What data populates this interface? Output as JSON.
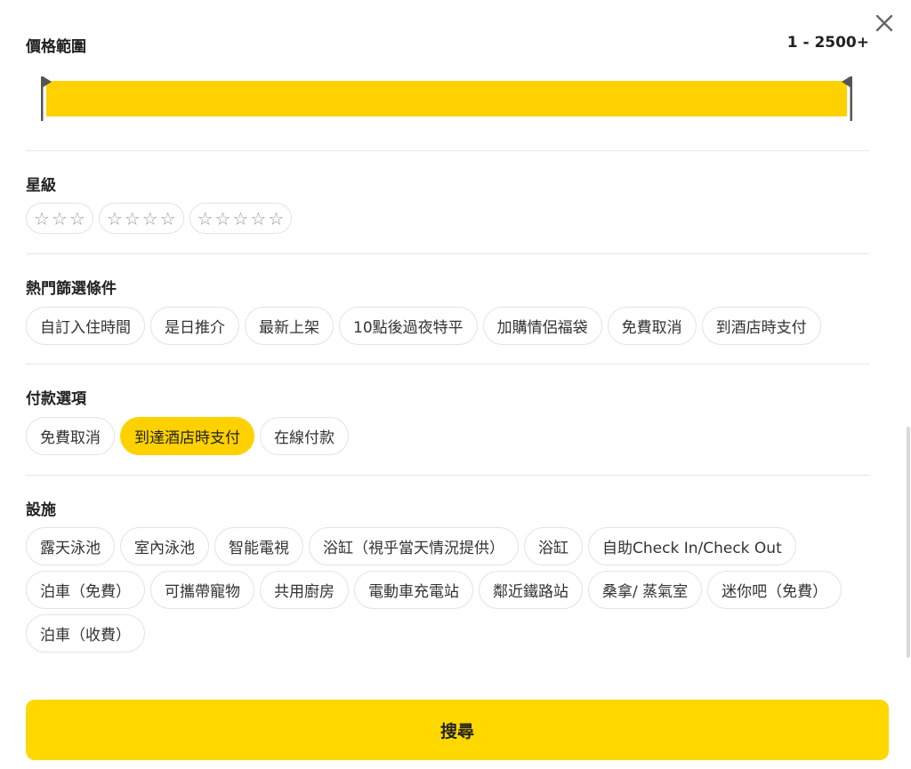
{
  "price": {
    "title": "價格範圍",
    "value": "1 - 2500+",
    "min_fraction": 0,
    "max_fraction": 1,
    "fill_color": "#ffd100"
  },
  "star_rating": {
    "title": "星級",
    "options": [
      {
        "stars": 3
      },
      {
        "stars": 4
      },
      {
        "stars": 5
      }
    ]
  },
  "popular_filters": {
    "title": "熱門篩選條件",
    "chips": [
      "自訂入住時間",
      "是日推介",
      "最新上架",
      "10點後過夜特平",
      "加購情侶福袋",
      "免費取消",
      "到酒店時支付"
    ]
  },
  "payment": {
    "title": "付款選項",
    "chips": [
      "免費取消",
      "到達酒店時支付",
      "在線付款"
    ],
    "selected": "到達酒店時支付"
  },
  "facilities": {
    "title": "設施",
    "chips": [
      "露天泳池",
      "室內泳池",
      "智能電視",
      "浴缸（視乎當天情況提供）",
      "浴缸",
      "自助Check In/Check Out",
      "泊車（免費）",
      "可攜帶寵物",
      "共用廚房",
      "電動車充電站",
      "鄰近鐵路站",
      "桑拿/ 蒸氣室",
      "迷你吧（免費）",
      "泊車（收費）"
    ]
  },
  "search_button": {
    "label": "搜尋"
  },
  "colors": {
    "accent": "#ffd100",
    "button": "#ffd800"
  },
  "icons": {
    "close": "close-icon",
    "star": "star-outline-icon"
  }
}
